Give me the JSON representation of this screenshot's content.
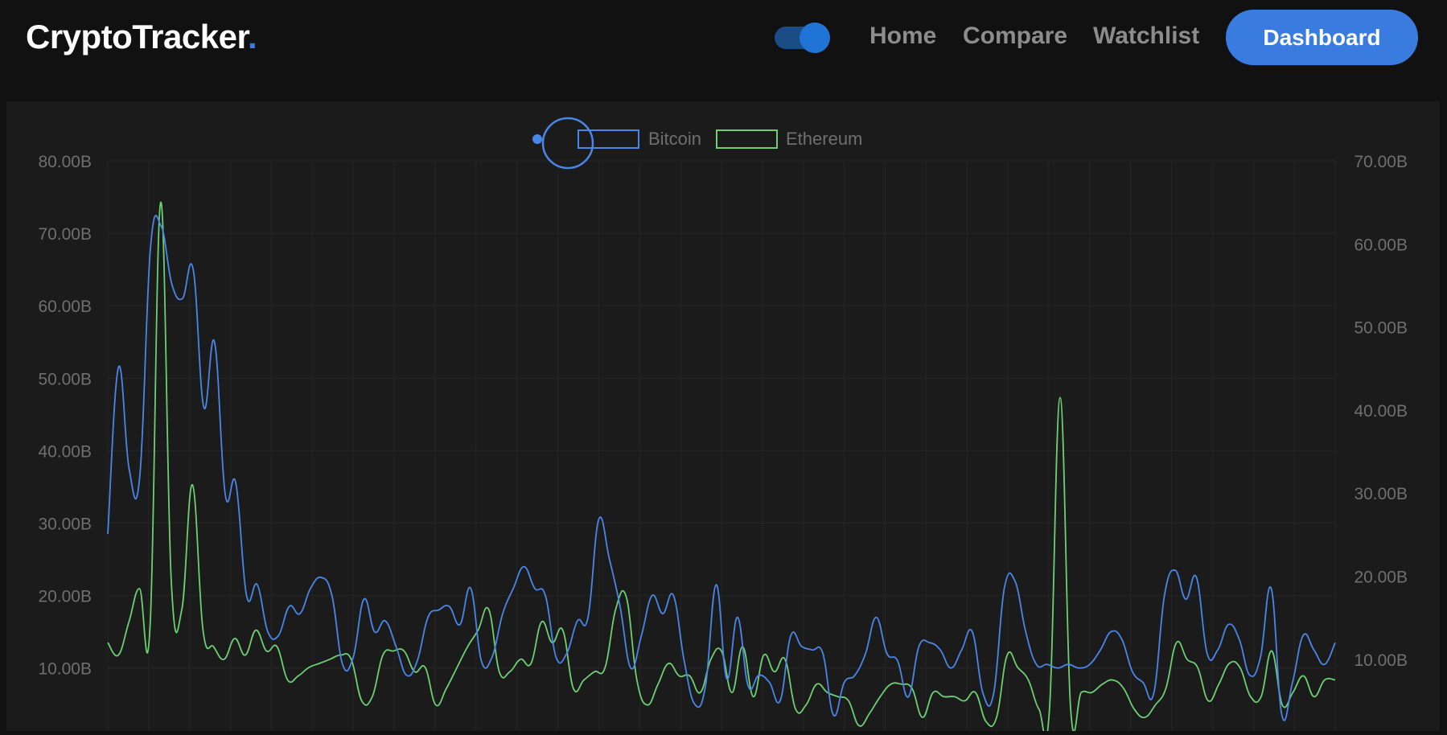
{
  "header": {
    "logo_text": "CryptoTracker",
    "logo_dot": ".",
    "theme_toggle": "on",
    "nav": [
      "Home",
      "Compare",
      "Watchlist"
    ],
    "dashboard_label": "Dashboard"
  },
  "colors": {
    "background": "#111111",
    "card": "#1b1b1b",
    "accent": "#3a7be0",
    "bitcoin": "#4a86e8",
    "ethereum": "#6ccf73",
    "axis_text": "#6f6f6f",
    "grid": "#262626"
  },
  "chart_data": {
    "type": "line",
    "legend_position": "top-center",
    "grid": true,
    "left_axis": {
      "ylim": [
        0,
        80
      ],
      "ticks": [
        10,
        20,
        30,
        40,
        50,
        60,
        70,
        80
      ],
      "tick_labels": [
        "10.00B",
        "20.00B",
        "30.00B",
        "40.00B",
        "50.00B",
        "60.00B",
        "70.00B",
        "80.00B"
      ]
    },
    "right_axis": {
      "ylim": [
        0,
        70
      ],
      "ticks": [
        10,
        20,
        30,
        40,
        50,
        60,
        70
      ],
      "tick_labels": [
        "10.00B",
        "20.00B",
        "30.00B",
        "40.00B",
        "50.00B",
        "60.00B",
        "70.00B"
      ]
    },
    "series": [
      {
        "name": "Bitcoin",
        "axis": "left",
        "color": "#4a86e8",
        "values": [
          28.5,
          51.5,
          37.5,
          36.5,
          68.0,
          71.0,
          63.0,
          61.0,
          65.0,
          46.0,
          55.0,
          34.0,
          35.5,
          20.0,
          21.5,
          15.0,
          14.5,
          18.5,
          17.5,
          21.0,
          22.5,
          20.0,
          10.5,
          11.5,
          19.5,
          15.0,
          16.5,
          13.0,
          9.0,
          11.0,
          17.0,
          18.0,
          18.5,
          16.0,
          21.0,
          11.0,
          11.5,
          17.5,
          21.0,
          24.0,
          21.0,
          20.0,
          11.5,
          12.0,
          16.5,
          17.0,
          30.5,
          25.0,
          18.5,
          10.0,
          14.5,
          20.0,
          17.5,
          20.0,
          11.0,
          5.0,
          7.5,
          21.5,
          8.5,
          17.0,
          7.5,
          9.0,
          8.0,
          5.5,
          14.5,
          13.0,
          12.5,
          12.0,
          3.5,
          8.0,
          9.0,
          12.0,
          17.0,
          12.0,
          11.0,
          6.0,
          13.0,
          13.5,
          12.5,
          10.0,
          12.5,
          15.0,
          6.5,
          6.5,
          21.0,
          22.0,
          15.0,
          10.5,
          10.5,
          10.0,
          10.5,
          10.0,
          10.5,
          12.5,
          15.0,
          14.0,
          9.5,
          8.0,
          6.5,
          20.0,
          23.5,
          19.5,
          22.5,
          12.0,
          12.5,
          16.0,
          14.0,
          9.0,
          11.5,
          21.0,
          3.5,
          8.0,
          14.5,
          12.5,
          10.5,
          13.5
        ]
      },
      {
        "name": "Ethereum",
        "axis": "right",
        "color": "#6ccf73",
        "values": [
          12.0,
          10.5,
          14.5,
          18.5,
          14.0,
          65.0,
          19.5,
          16.0,
          31.0,
          13.5,
          11.5,
          10.0,
          12.5,
          10.5,
          13.5,
          11.0,
          11.5,
          7.5,
          8.0,
          9.0,
          9.5,
          10.0,
          10.5,
          10.0,
          5.0,
          5.5,
          10.5,
          11.0,
          11.0,
          8.5,
          9.0,
          4.5,
          6.5,
          9.0,
          11.5,
          13.5,
          16.0,
          8.5,
          8.5,
          10.0,
          9.5,
          14.5,
          12.0,
          13.5,
          6.5,
          7.5,
          8.5,
          9.0,
          16.0,
          17.5,
          7.5,
          4.5,
          7.0,
          9.5,
          8.0,
          8.0,
          6.0,
          10.0,
          11.0,
          6.0,
          11.5,
          5.5,
          10.5,
          8.5,
          10.0,
          4.0,
          4.5,
          7.0,
          6.0,
          5.5,
          5.0,
          2.0,
          3.5,
          5.5,
          7.0,
          7.0,
          6.5,
          3.0,
          6.0,
          5.5,
          5.5,
          5.0,
          6.0,
          2.5,
          3.0,
          10.5,
          9.0,
          7.5,
          4.0,
          4.0,
          41.5,
          4.0,
          6.0,
          6.0,
          7.0,
          7.5,
          6.5,
          4.0,
          3.0,
          4.5,
          6.5,
          12.0,
          10.0,
          9.0,
          5.0,
          7.0,
          9.5,
          9.0,
          5.5,
          5.5,
          11.0,
          4.5,
          6.0,
          8.0,
          5.5,
          7.5,
          7.5
        ]
      }
    ]
  }
}
